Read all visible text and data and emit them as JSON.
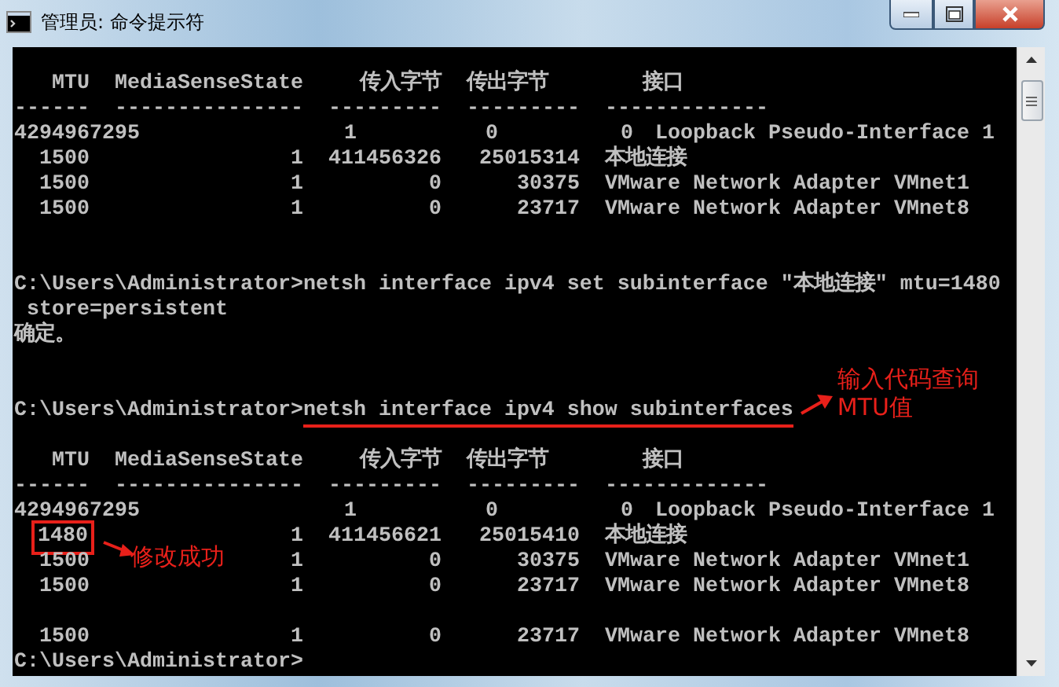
{
  "window": {
    "title": "管理员: 命令提示符"
  },
  "console": {
    "lines": [
      {
        "kind": "blank"
      },
      {
        "kind": "header",
        "cells": [
          "MTU",
          "MediaSenseState",
          "传入字节",
          "传出字节",
          "接口"
        ]
      },
      {
        "kind": "rule",
        "cells": [
          "------",
          "---------------",
          "---------",
          "---------",
          "-------------"
        ]
      },
      {
        "kind": "overflow_row",
        "cells": [
          "4294967295",
          "1",
          "0",
          "0",
          "Loopback Pseudo-Interface 1"
        ]
      },
      {
        "kind": "row",
        "cells": [
          "1500",
          "1",
          "411456326",
          "25015314",
          "本地连接"
        ]
      },
      {
        "kind": "row",
        "cells": [
          "1500",
          "1",
          "0",
          "30375",
          "VMware Network Adapter VMnet1"
        ]
      },
      {
        "kind": "row",
        "cells": [
          "1500",
          "1",
          "0",
          "23717",
          "VMware Network Adapter VMnet8"
        ]
      },
      {
        "kind": "blank"
      },
      {
        "kind": "blank"
      },
      {
        "kind": "prompt",
        "prompt": "C:\\Users\\Administrator>",
        "command": "netsh interface ipv4 set subinterface \"本地连接\" mtu=1480",
        "underlined": false
      },
      {
        "kind": "text",
        "text": " store=persistent"
      },
      {
        "kind": "text",
        "text": "确定。"
      },
      {
        "kind": "blank"
      },
      {
        "kind": "blank"
      },
      {
        "kind": "prompt",
        "prompt": "C:\\Users\\Administrator>",
        "command": "netsh interface ipv4 show subinterfaces",
        "underlined": true,
        "note": [
          "输入代码查询",
          "MTU值"
        ]
      },
      {
        "kind": "blank"
      },
      {
        "kind": "header",
        "cells": [
          "MTU",
          "MediaSenseState",
          "传入字节",
          "传出字节",
          "接口"
        ]
      },
      {
        "kind": "rule",
        "cells": [
          "------",
          "---------------",
          "---------",
          "---------",
          "-------------"
        ]
      },
      {
        "kind": "overflow_row",
        "cells": [
          "4294967295",
          "1",
          "0",
          "0",
          "Loopback Pseudo-Interface 1"
        ]
      },
      {
        "kind": "row",
        "cells": [
          "1480",
          "1",
          "411456621",
          "25015410",
          "本地连接"
        ],
        "highlighted": true,
        "note": "修改成功"
      },
      {
        "kind": "row",
        "cells": [
          "1500",
          "1",
          "0",
          "30375",
          "VMware Network Adapter VMnet1"
        ]
      },
      {
        "kind": "row",
        "cells": [
          "1500",
          "1",
          "0",
          "23717",
          "VMware Network Adapter VMnet8"
        ]
      },
      {
        "kind": "blank"
      },
      {
        "kind": "row",
        "cells": [
          "1500",
          "1",
          "0",
          "23717",
          "VMware Network Adapter VMnet8"
        ]
      },
      {
        "kind": "prompt",
        "prompt": "C:\\Users\\Administrator>"
      }
    ]
  }
}
